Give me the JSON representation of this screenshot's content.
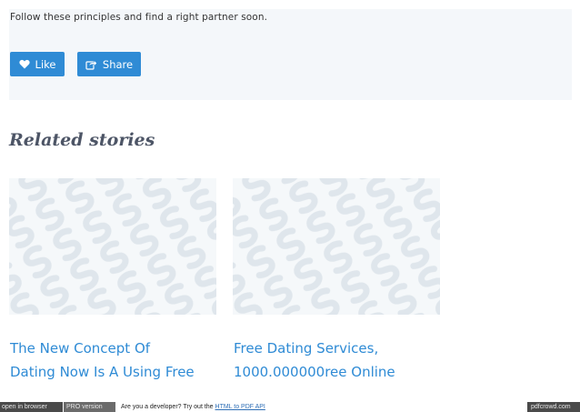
{
  "share_panel": {
    "intro_text": "Follow these principles and find a right partner soon.",
    "like_label": "Like",
    "share_label": "Share"
  },
  "related": {
    "heading": "Related stories",
    "stories": [
      {
        "title_line1": "The New Concept Of",
        "title_line2": "Dating Now Is A Using Free"
      },
      {
        "title_line1": "Free Dating Services,",
        "title_line2": "1000.000000ree Online"
      }
    ]
  },
  "footer": {
    "open_in_browser": "open in browser",
    "pro_version": "PRO version",
    "developer_prefix": "Are you a developer? Try out the",
    "api_link": "HTML to PDF API",
    "brand": "pdfcrowd.com"
  },
  "colors": {
    "accent": "#2f8bd5",
    "panel_bg": "#f4f7fa",
    "heading": "#4d5566"
  },
  "icons": [
    "heart-icon",
    "share-icon",
    "placeholder-pattern"
  ]
}
